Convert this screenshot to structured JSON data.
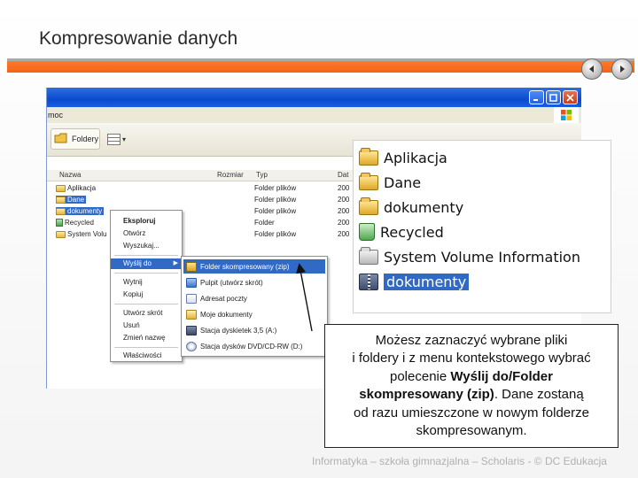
{
  "slide": {
    "title": "Kompresowanie danych",
    "footer": "Informatyka – szkoła gimnazjalna – Scholaris - © DC Edukacja"
  },
  "nav": {
    "prev_icon": "previous-arrow-icon",
    "next_icon": "next-arrow-icon"
  },
  "explorer": {
    "menu_fragment": "moc",
    "toolbar": {
      "folders_label": "Foldery"
    },
    "columns": [
      "Nazwa",
      "Rozmiar",
      "Typ",
      "Dat"
    ],
    "files": [
      {
        "name": "Aplikacja",
        "type": "Folder plików",
        "date": "200",
        "selected": false
      },
      {
        "name": "Dane",
        "type": "Folder plików",
        "date": "200",
        "selected": true
      },
      {
        "name": "dokumenty",
        "type": "Folder plików",
        "date": "200",
        "selected": true
      },
      {
        "name": "Recycled",
        "type": "Folder",
        "date": "200",
        "selected": false
      },
      {
        "name": "System Volu",
        "type": "Folder plików",
        "date": "200",
        "selected": false
      }
    ]
  },
  "context_menu": {
    "items": [
      {
        "label": "Eksploruj",
        "bold": true
      },
      {
        "label": "Otwórz"
      },
      {
        "label": "Wyszukaj..."
      },
      {
        "label": "Wyślij do",
        "highlighted": true,
        "submenu": true
      },
      {
        "label": "Wytnij"
      },
      {
        "label": "Kopiuj"
      },
      {
        "label": "Utwórz skrót"
      },
      {
        "label": "Usuń"
      },
      {
        "label": "Zmień nazwę"
      },
      {
        "label": "Właściwości"
      }
    ]
  },
  "send_to_menu": {
    "items": [
      {
        "label": "Folder skompresowany (zip)",
        "icon": "zip-folder-icon",
        "highlighted": true
      },
      {
        "label": "Pulpit (utwórz skrót)",
        "icon": "desktop-icon"
      },
      {
        "label": "Adresat poczty",
        "icon": "mail-recipient-icon"
      },
      {
        "label": "Moje dokumenty",
        "icon": "my-documents-icon"
      },
      {
        "label": "Stacja dyskietek 3,5 (A:)",
        "icon": "floppy-drive-icon"
      },
      {
        "label": "Stacja dysków DVD/CD-RW (D:)",
        "icon": "cd-drive-icon"
      }
    ]
  },
  "zoom_panel": {
    "items": [
      {
        "name": "Aplikacja",
        "icon": "folder-icon"
      },
      {
        "name": "Dane",
        "icon": "folder-icon"
      },
      {
        "name": "dokumenty",
        "icon": "folder-icon"
      },
      {
        "name": "Recycled",
        "icon": "recycle-bin-icon"
      },
      {
        "name": "System Volume Information",
        "icon": "system-folder-icon"
      },
      {
        "name": "dokumenty",
        "icon": "zip-folder-icon",
        "selected": true
      }
    ]
  },
  "callout": {
    "line1": "Możesz zaznaczyć wybrane pliki",
    "line2": "i foldery i z menu kontekstowego wybrać",
    "line3_pre": "polecenie ",
    "line3_bold": "Wyślij do/Folder",
    "line4_bold": "skompresowany (zip)",
    "line4_post": ". Dane zostaną",
    "line5": "od razu umieszczone w nowym folderze",
    "line6": "skompresowanym."
  },
  "colors": {
    "accent_orange": "#f26418",
    "selection_blue": "#316ac5",
    "titlebar_blue": "#0a4ad0"
  }
}
